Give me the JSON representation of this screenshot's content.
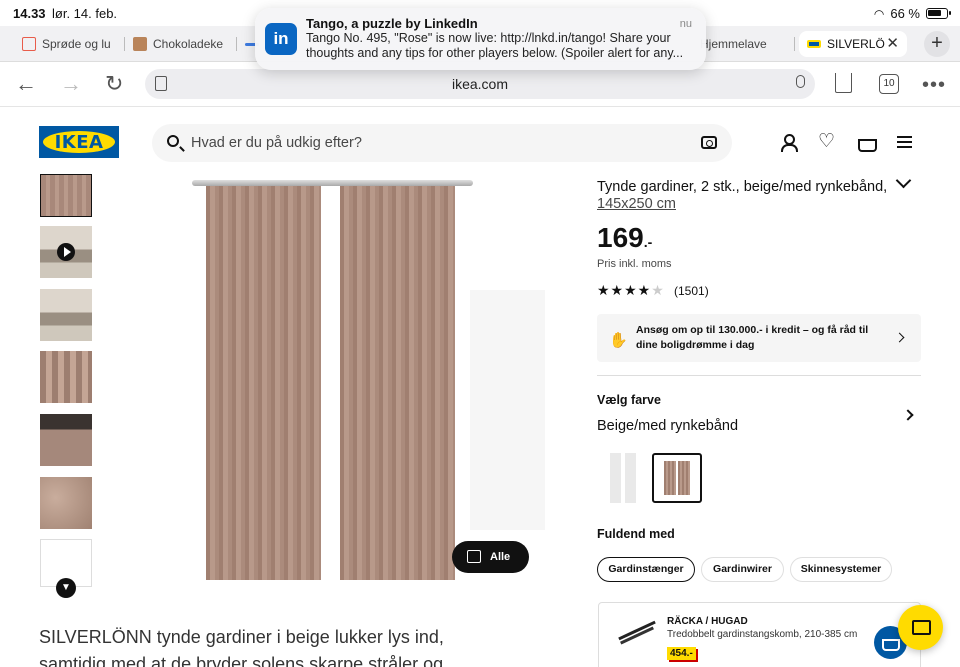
{
  "status": {
    "time": "14.33",
    "date": "lør. 14. feb.",
    "battery": "66 %",
    "wifi_icon": "wifi-icon"
  },
  "tabs": [
    {
      "label": "Sprøde og lu",
      "color": "#e85c4a"
    },
    {
      "label": "Chokoladeke",
      "color": "#b9845a"
    },
    {
      "label": "",
      "color": "#3d7be0"
    },
    {
      "label": "Hjemmelave",
      "color": "#cccccc"
    },
    {
      "label": "SILVERLÖ",
      "color": "#0058a3"
    }
  ],
  "notification": {
    "app": "LinkedIn",
    "title": "Tango, a puzzle by LinkedIn",
    "body": "Tango No. 495, \"Rose\" is now live: http://lnkd.in/tango! Share your thoughts and any tips for other players below. (Spoiler alert for any...",
    "time": "nu"
  },
  "browser": {
    "url": "ikea.com",
    "tab_count": "10"
  },
  "header": {
    "logo": "IKEA",
    "search_placeholder": "Hvad er du på udkig efter?"
  },
  "gallery": {
    "all_label": "Alle"
  },
  "product": {
    "title": "Tynde gardiner, 2 stk., beige/med rynkebånd,",
    "size": "145x250 cm",
    "price": "169",
    "price_suffix": ".-",
    "price_note": "Pris inkl. moms",
    "rating": 4,
    "rating_max": 5,
    "review_count": "(1501)",
    "credit_text": "Ansøg om op til 130.000.- i kredit – og få råd til dine boligdrømme i dag",
    "color_heading": "Vælg farve",
    "color_value": "Beige/med rynkebånd",
    "complete_heading": "Fuldend med",
    "complete_options": [
      "Gardinstænger",
      "Gardinwirer",
      "Skinnesystemer"
    ],
    "accessory": {
      "name": "RÄCKA / HUGAD",
      "description": "Tredobbelt gardinstangskomb, 210-385 cm",
      "price": "454.-"
    },
    "description": "SILVERLÖNN tynde gardiner i beige lukker lys ind, samtidig med at de bryder solens skarpe stråler og"
  }
}
